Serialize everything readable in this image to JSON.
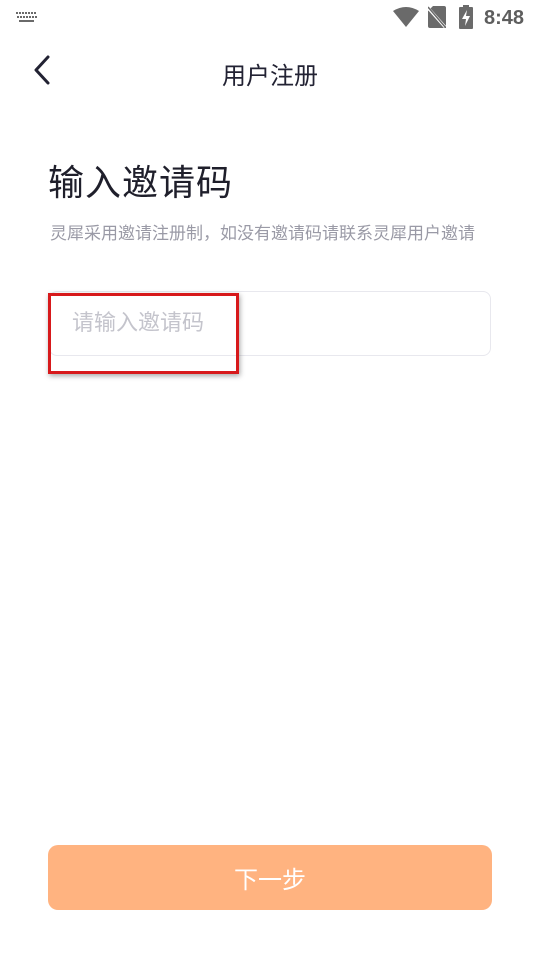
{
  "status_bar": {
    "time": "8:48",
    "icons": [
      "keyboard-icon",
      "wifi-icon",
      "no-sim-icon",
      "battery-charging-icon"
    ]
  },
  "header": {
    "back_icon": "chevron-left-icon",
    "title": "用户注册"
  },
  "main": {
    "heading": "输入邀请码",
    "hint": "灵犀采用邀请注册制，如没有邀请码请联系灵犀用户邀请",
    "invite_code": {
      "value": "",
      "placeholder": "请输入邀请码"
    },
    "next_label": "下一步"
  },
  "colors": {
    "primary_button": "#ffb380",
    "highlight": "#d7191b",
    "hint_text": "#9a9aa6",
    "placeholder_text": "#c4c4cc"
  }
}
